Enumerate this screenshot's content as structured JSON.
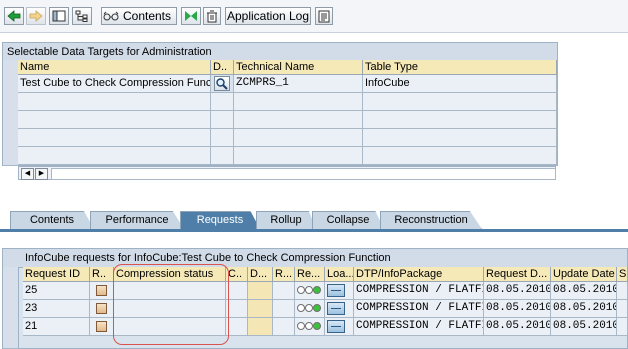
{
  "toolbar": {
    "contents_label": "Contents",
    "application_log_label": "Application Log"
  },
  "targets": {
    "title": "Selectable Data Targets for Administration",
    "columns": [
      "Name",
      "D..",
      "Technical Name",
      "Table Type"
    ],
    "rows": [
      {
        "name": "Test Cube to Check Compression Func",
        "technical_name": "ZCMPRS_1",
        "table_type": "InfoCube"
      }
    ]
  },
  "tabs": [
    "Contents",
    "Performance",
    "Requests",
    "Rollup",
    "Collapse",
    "Reconstruction"
  ],
  "active_tab": "Requests",
  "requests": {
    "title": "InfoCube requests for InfoCube:Test Cube to Check Compression Function",
    "columns": [
      "Request ID",
      "R..",
      "Compression status",
      "C..",
      "D...",
      "R...",
      "Re...",
      "Loa...",
      "DTP/InfoPackage",
      "Request D...",
      "Update Date",
      "S"
    ],
    "rows": [
      {
        "request_id": "25",
        "dtp": "COMPRESSION / FLATFIL",
        "request_date": "08.05.2010",
        "update_date": "08.05.2010"
      },
      {
        "request_id": "23",
        "dtp": "COMPRESSION / FLATFIL",
        "request_date": "08.05.2010",
        "update_date": "08.05.2010"
      },
      {
        "request_id": "21",
        "dtp": "COMPRESSION / FLATFIL",
        "request_date": "08.05.2010",
        "update_date": "08.05.2010"
      }
    ]
  },
  "colors": {
    "highlight_box": "#d9534f",
    "active_tab": "#4f7fa8",
    "header_bg": "#f6e9b8"
  }
}
